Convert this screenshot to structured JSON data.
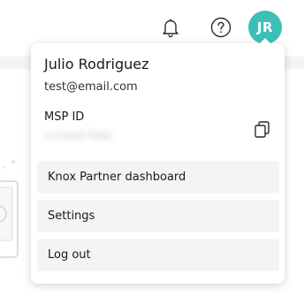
{
  "header": {
    "bell_icon": "bell-icon",
    "help_icon": "help-circle-icon",
    "avatar_initials": "JR",
    "avatar_color": "#3dbfb8"
  },
  "profile_menu": {
    "user_name": "Julio Rodriguez",
    "email": "test@email.com",
    "msp_label": "MSP ID",
    "msp_value": "1234567890",
    "copy_icon": "copy-icon",
    "items": [
      {
        "label": "Knox Partner dashboard"
      },
      {
        "label": "Settings"
      },
      {
        "label": "Log out"
      }
    ]
  }
}
